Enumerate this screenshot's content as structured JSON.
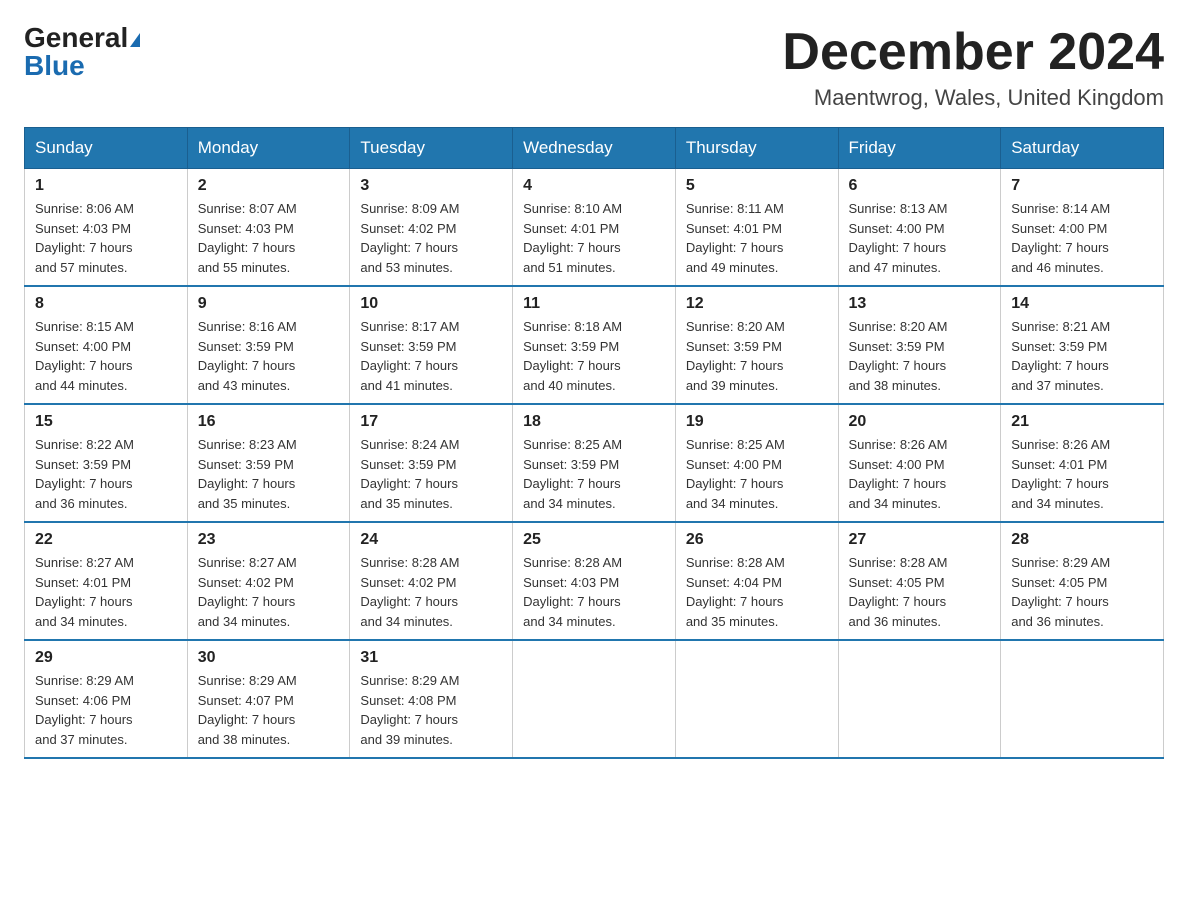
{
  "header": {
    "logo_line1": "General",
    "logo_line2": "Blue",
    "month_title": "December 2024",
    "location": "Maentwrog, Wales, United Kingdom"
  },
  "weekdays": [
    "Sunday",
    "Monday",
    "Tuesday",
    "Wednesday",
    "Thursday",
    "Friday",
    "Saturday"
  ],
  "weeks": [
    [
      {
        "day": "1",
        "info": "Sunrise: 8:06 AM\nSunset: 4:03 PM\nDaylight: 7 hours\nand 57 minutes."
      },
      {
        "day": "2",
        "info": "Sunrise: 8:07 AM\nSunset: 4:03 PM\nDaylight: 7 hours\nand 55 minutes."
      },
      {
        "day": "3",
        "info": "Sunrise: 8:09 AM\nSunset: 4:02 PM\nDaylight: 7 hours\nand 53 minutes."
      },
      {
        "day": "4",
        "info": "Sunrise: 8:10 AM\nSunset: 4:01 PM\nDaylight: 7 hours\nand 51 minutes."
      },
      {
        "day": "5",
        "info": "Sunrise: 8:11 AM\nSunset: 4:01 PM\nDaylight: 7 hours\nand 49 minutes."
      },
      {
        "day": "6",
        "info": "Sunrise: 8:13 AM\nSunset: 4:00 PM\nDaylight: 7 hours\nand 47 minutes."
      },
      {
        "day": "7",
        "info": "Sunrise: 8:14 AM\nSunset: 4:00 PM\nDaylight: 7 hours\nand 46 minutes."
      }
    ],
    [
      {
        "day": "8",
        "info": "Sunrise: 8:15 AM\nSunset: 4:00 PM\nDaylight: 7 hours\nand 44 minutes."
      },
      {
        "day": "9",
        "info": "Sunrise: 8:16 AM\nSunset: 3:59 PM\nDaylight: 7 hours\nand 43 minutes."
      },
      {
        "day": "10",
        "info": "Sunrise: 8:17 AM\nSunset: 3:59 PM\nDaylight: 7 hours\nand 41 minutes."
      },
      {
        "day": "11",
        "info": "Sunrise: 8:18 AM\nSunset: 3:59 PM\nDaylight: 7 hours\nand 40 minutes."
      },
      {
        "day": "12",
        "info": "Sunrise: 8:20 AM\nSunset: 3:59 PM\nDaylight: 7 hours\nand 39 minutes."
      },
      {
        "day": "13",
        "info": "Sunrise: 8:20 AM\nSunset: 3:59 PM\nDaylight: 7 hours\nand 38 minutes."
      },
      {
        "day": "14",
        "info": "Sunrise: 8:21 AM\nSunset: 3:59 PM\nDaylight: 7 hours\nand 37 minutes."
      }
    ],
    [
      {
        "day": "15",
        "info": "Sunrise: 8:22 AM\nSunset: 3:59 PM\nDaylight: 7 hours\nand 36 minutes."
      },
      {
        "day": "16",
        "info": "Sunrise: 8:23 AM\nSunset: 3:59 PM\nDaylight: 7 hours\nand 35 minutes."
      },
      {
        "day": "17",
        "info": "Sunrise: 8:24 AM\nSunset: 3:59 PM\nDaylight: 7 hours\nand 35 minutes."
      },
      {
        "day": "18",
        "info": "Sunrise: 8:25 AM\nSunset: 3:59 PM\nDaylight: 7 hours\nand 34 minutes."
      },
      {
        "day": "19",
        "info": "Sunrise: 8:25 AM\nSunset: 4:00 PM\nDaylight: 7 hours\nand 34 minutes."
      },
      {
        "day": "20",
        "info": "Sunrise: 8:26 AM\nSunset: 4:00 PM\nDaylight: 7 hours\nand 34 minutes."
      },
      {
        "day": "21",
        "info": "Sunrise: 8:26 AM\nSunset: 4:01 PM\nDaylight: 7 hours\nand 34 minutes."
      }
    ],
    [
      {
        "day": "22",
        "info": "Sunrise: 8:27 AM\nSunset: 4:01 PM\nDaylight: 7 hours\nand 34 minutes."
      },
      {
        "day": "23",
        "info": "Sunrise: 8:27 AM\nSunset: 4:02 PM\nDaylight: 7 hours\nand 34 minutes."
      },
      {
        "day": "24",
        "info": "Sunrise: 8:28 AM\nSunset: 4:02 PM\nDaylight: 7 hours\nand 34 minutes."
      },
      {
        "day": "25",
        "info": "Sunrise: 8:28 AM\nSunset: 4:03 PM\nDaylight: 7 hours\nand 34 minutes."
      },
      {
        "day": "26",
        "info": "Sunrise: 8:28 AM\nSunset: 4:04 PM\nDaylight: 7 hours\nand 35 minutes."
      },
      {
        "day": "27",
        "info": "Sunrise: 8:28 AM\nSunset: 4:05 PM\nDaylight: 7 hours\nand 36 minutes."
      },
      {
        "day": "28",
        "info": "Sunrise: 8:29 AM\nSunset: 4:05 PM\nDaylight: 7 hours\nand 36 minutes."
      }
    ],
    [
      {
        "day": "29",
        "info": "Sunrise: 8:29 AM\nSunset: 4:06 PM\nDaylight: 7 hours\nand 37 minutes."
      },
      {
        "day": "30",
        "info": "Sunrise: 8:29 AM\nSunset: 4:07 PM\nDaylight: 7 hours\nand 38 minutes."
      },
      {
        "day": "31",
        "info": "Sunrise: 8:29 AM\nSunset: 4:08 PM\nDaylight: 7 hours\nand 39 minutes."
      },
      {
        "day": "",
        "info": ""
      },
      {
        "day": "",
        "info": ""
      },
      {
        "day": "",
        "info": ""
      },
      {
        "day": "",
        "info": ""
      }
    ]
  ]
}
